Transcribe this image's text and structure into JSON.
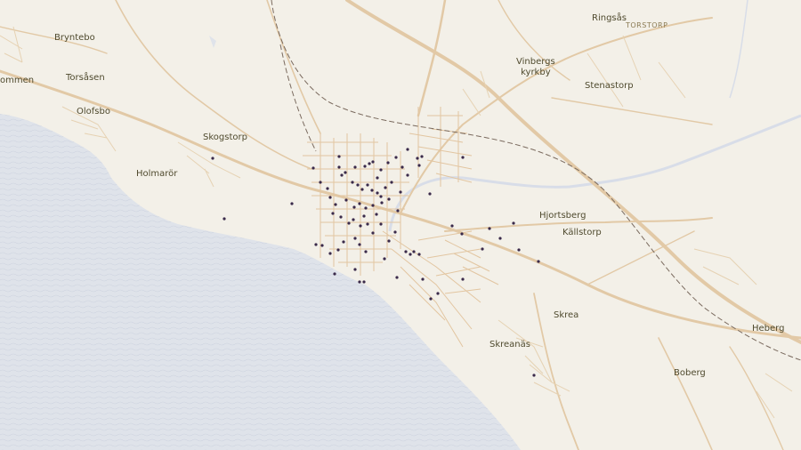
{
  "map": {
    "colors": {
      "land": "#f3f0e8",
      "water": "#dfe3ea",
      "road": "#e2c9a6",
      "railway": "#7a6a5e",
      "poi": "#3a2a4a"
    },
    "labels": {
      "bryntebo": "Bryntebo",
      "ommen": "ommen",
      "torsasen": "Torsåsen",
      "olofsbo": "Olofsbo",
      "skogstorp": "Skogstorp",
      "holmaror": "Holmarör",
      "ringsas": "Ringsås",
      "torstorp": "TORSTORP",
      "vinbergs_kyrkby_line1": "Vinbergs",
      "vinbergs_kyrkby_line2": "kyrkby",
      "stenastorp": "Stenastorp",
      "hjortsberg": "Hjortsberg",
      "kallstorp": "Källstorp",
      "skrea": "Skrea",
      "skreanas": "Skreanäs",
      "heberg": "Heberg",
      "boberg": "Boberg"
    }
  }
}
